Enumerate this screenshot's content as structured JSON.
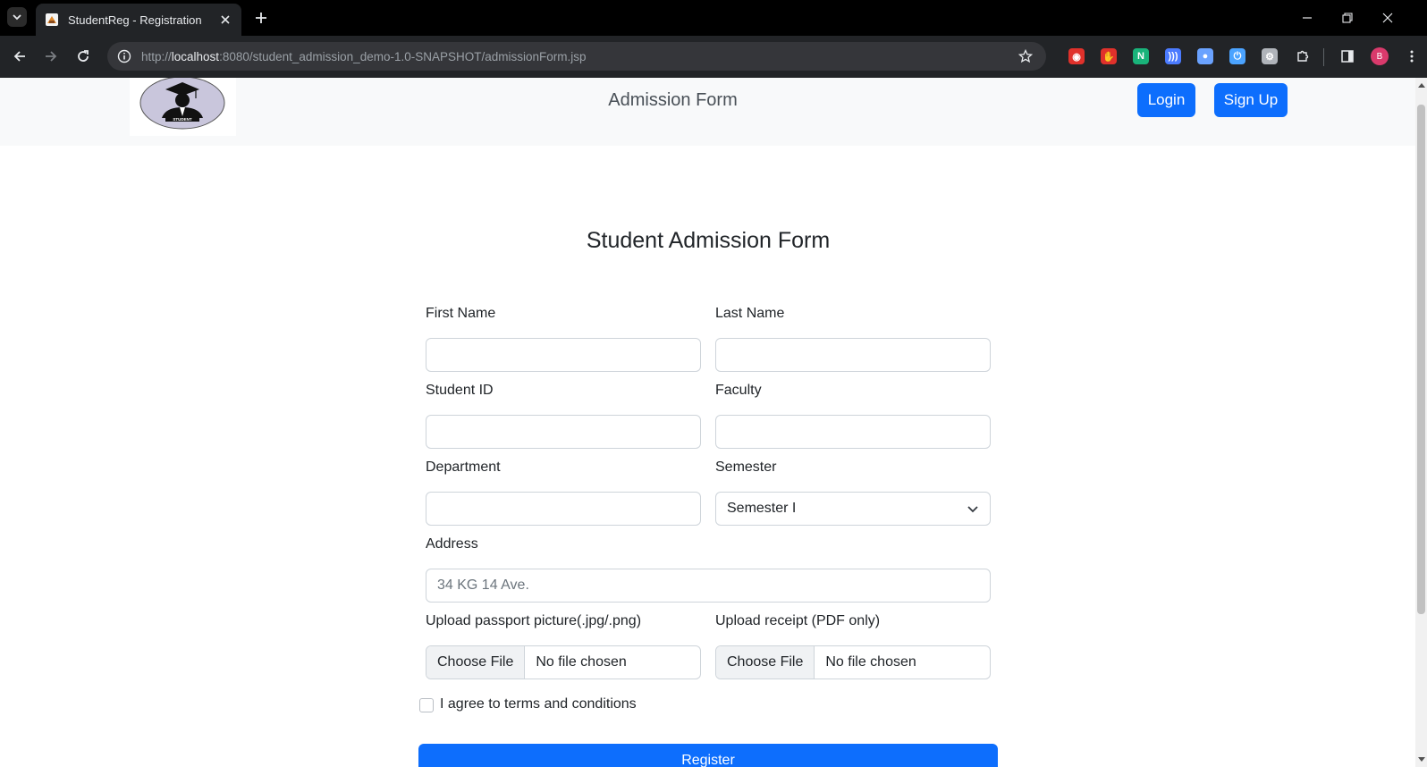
{
  "browser": {
    "tab_title": "StudentReg - Registration",
    "url_scheme": "http://",
    "url_host": "localhost",
    "url_path": ":8080/student_admission_demo-1.0-SNAPSHOT/admissionForm.jsp",
    "profile_initial": "B",
    "extensions": [
      {
        "name": "red-circle-extension",
        "color": "#e0312b",
        "glyph": "◉"
      },
      {
        "name": "red-hand-extension",
        "color": "#e0312b",
        "glyph": "✋"
      },
      {
        "name": "n-extension",
        "color": "#19b37a",
        "glyph": "N"
      },
      {
        "name": "wave-extension",
        "color": "#4b7bff",
        "glyph": ")))"
      },
      {
        "name": "search-extension",
        "color": "#6aa2ff",
        "glyph": "●"
      },
      {
        "name": "power-extension",
        "color": "#4ba3ff",
        "glyph": "⏻"
      },
      {
        "name": "gear-extension",
        "color": "#b0b4ba",
        "glyph": "⚙"
      }
    ]
  },
  "header": {
    "title": "Admission Form",
    "login_label": "Login",
    "signup_label": "Sign Up",
    "logo_text": "STUDENT"
  },
  "form": {
    "title": "Student Admission Form",
    "first_name_label": "First Name",
    "last_name_label": "Last Name",
    "student_id_label": "Student ID",
    "faculty_label": "Faculty",
    "department_label": "Department",
    "semester_label": "Semester",
    "semester_value": "Semester I",
    "address_label": "Address",
    "address_placeholder": "34 KG 14 Ave.",
    "passport_label": "Upload passport picture(.jpg/.png)",
    "receipt_label": "Upload receipt (PDF only)",
    "choose_file_label": "Choose File",
    "no_file_text": "No file chosen",
    "terms_label": "I agree to terms and conditions",
    "register_label": "Register"
  },
  "colors": {
    "primary": "#0d6efd",
    "header_bg": "#f8f9fa"
  }
}
